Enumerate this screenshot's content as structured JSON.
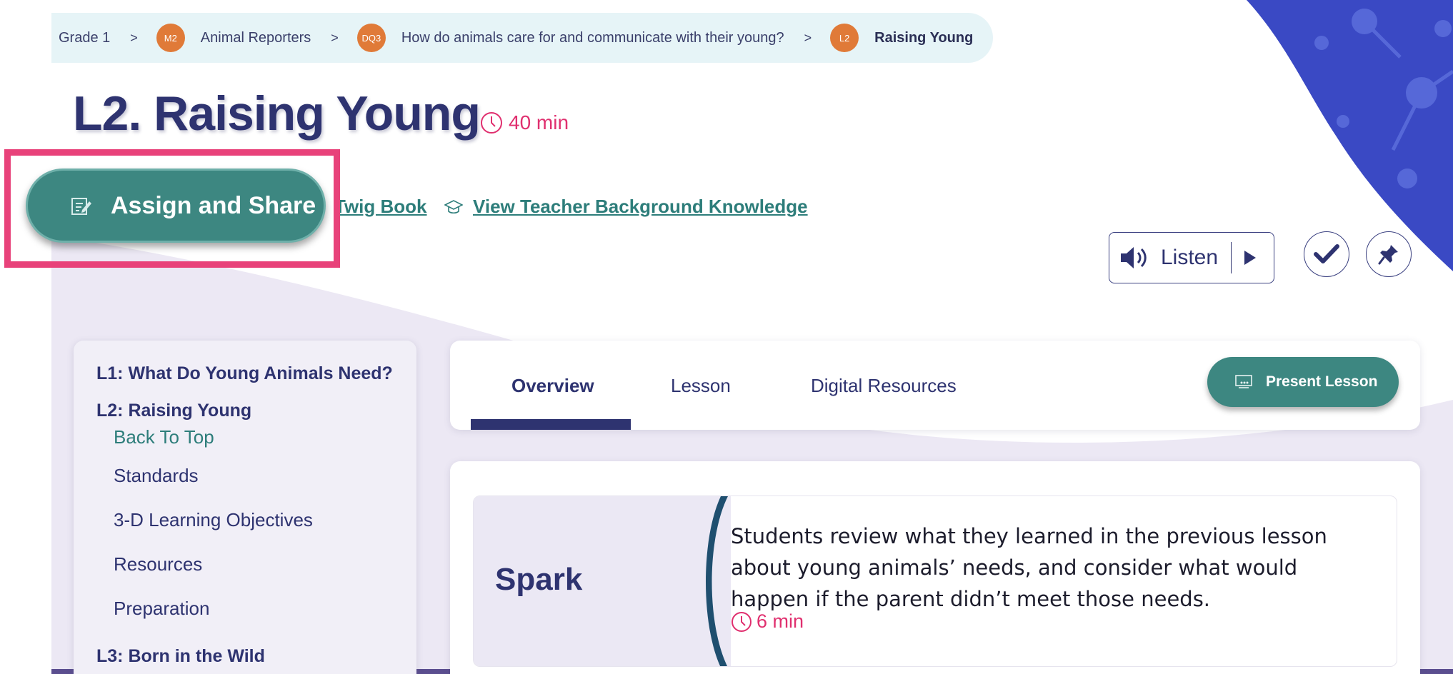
{
  "breadcrumb": {
    "grade": "Grade 1",
    "separator": ">",
    "module_badge": "M2",
    "module": "Animal Reporters",
    "dq_badge": "DQ3",
    "driving_question": "How do animals care for and communicate with their young?",
    "lesson_badge": "L2",
    "lesson": "Raising Young"
  },
  "header": {
    "title": "L2. Raising Young",
    "duration": "40 min"
  },
  "actions": {
    "assign_label": "Assign and Share",
    "book_link": "Twig Book",
    "teacher_link": "View Teacher Background Knowledge",
    "listen_label": "Listen"
  },
  "sidebar": {
    "lessons": [
      {
        "label": "L1: What Do Young Animals Need?"
      },
      {
        "label": "L2: Raising Young"
      },
      {
        "label": "L3: Born in the Wild"
      }
    ],
    "sub_items": [
      {
        "label": "Back To Top"
      },
      {
        "label": "Standards"
      },
      {
        "label": "3-D Learning Objectives"
      },
      {
        "label": "Resources"
      },
      {
        "label": "Preparation"
      }
    ]
  },
  "tabs": {
    "items": [
      {
        "label": "Overview"
      },
      {
        "label": "Lesson"
      },
      {
        "label": "Digital Resources"
      }
    ],
    "present_label": "Present Lesson"
  },
  "section": {
    "title": "Spark",
    "description": "Students review what they learned in the previous lesson about young animals’ needs, and consider what would happen if the parent didn’t meet those needs.",
    "duration": "6 min"
  },
  "colors": {
    "navy": "#2e3370",
    "teal": "#3d8781",
    "pink": "#e0306f",
    "orange_badge": "#e07a38",
    "highlight": "#e8427a"
  }
}
